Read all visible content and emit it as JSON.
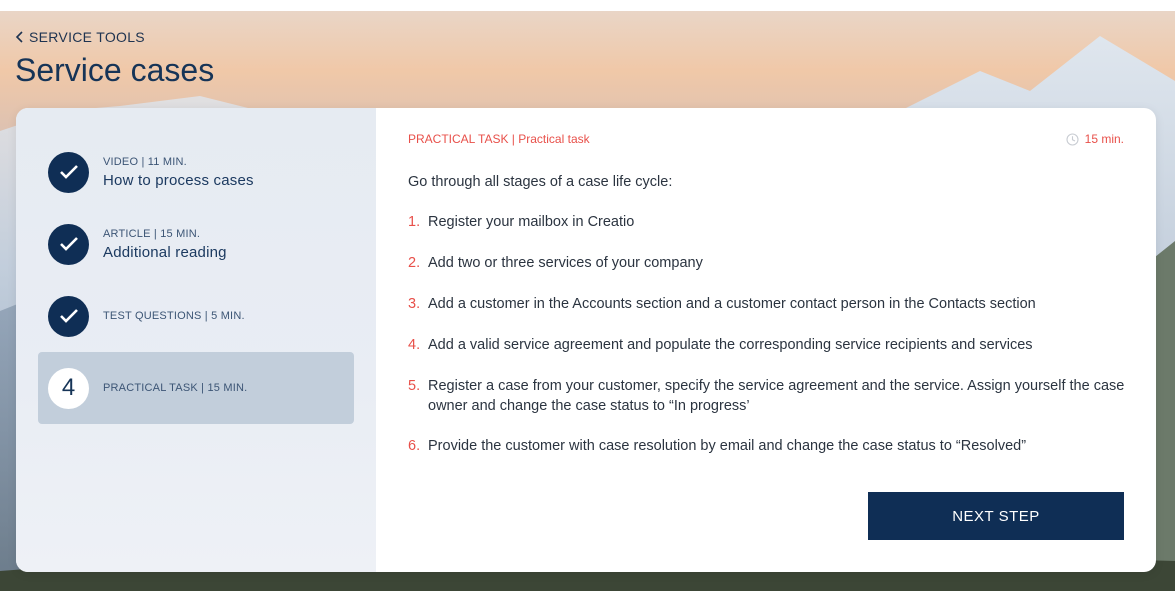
{
  "header": {
    "back_label": "SERVICE TOOLS",
    "page_title": "Service cases"
  },
  "steps": [
    {
      "meta": "VIDEO | 11 MIN.",
      "title": "How to process cases",
      "state": "done"
    },
    {
      "meta": "ARTICLE | 15 MIN.",
      "title": "Additional reading",
      "state": "done"
    },
    {
      "meta": "TEST QUESTIONS | 5 MIN.",
      "title": "",
      "state": "done"
    },
    {
      "meta": "PRACTICAL TASK | 15 MIN.",
      "title": "",
      "state": "active",
      "number": "4"
    }
  ],
  "task": {
    "tag": "PRACTICAL TASK | Practical task",
    "duration": "15 min.",
    "intro": "Go through all stages of a case life cycle:",
    "items": [
      {
        "idx": "1.",
        "text": "Register your mailbox in  Creatio"
      },
      {
        "idx": "2.",
        "text": "Add two or three services of your company"
      },
      {
        "idx": "3.",
        "text": "Add a customer in the Accounts section and a customer contact person in the Contacts section"
      },
      {
        "idx": "4.",
        "text": "Add a valid service agreement and populate the corresponding  service recipients and services"
      },
      {
        "idx": "5.",
        "text": "Register a case from your customer, specify the service agreement and the service. Assign yourself the case owner and change the case status to “In progress’"
      },
      {
        "idx": "6.",
        "text": "Provide the customer with case resolution by email and change the case status to “Resolved”"
      }
    ],
    "next_label": "NEXT STEP"
  },
  "colors": {
    "accent": "#e8504a",
    "primary": "#0f2e55",
    "active_step_bg": "#c2cedb"
  },
  "icons": {
    "back": "chevron-left-icon",
    "done": "checkmark-icon",
    "duration": "clock-icon"
  }
}
